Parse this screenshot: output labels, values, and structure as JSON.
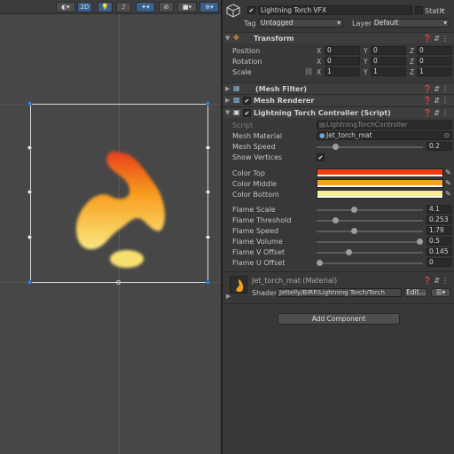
{
  "scene": {
    "toolbar": {
      "mode_2d": "2D",
      "shading_icon": "shading-mode-icon",
      "lighting_icon": "light-bulb-icon",
      "audio_icon": "audio-icon",
      "effects_icon": "effects-icon",
      "hidden_icon": "visibility-icon",
      "camera_icon": "camera-icon",
      "gizmos_icon": "gizmos-icon"
    }
  },
  "inspector": {
    "gameobject": {
      "active_checked": true,
      "name": "Lightning Torch VFX",
      "static_label": "Static",
      "tag_label": "Tag",
      "tag_value": "Untagged",
      "layer_label": "Layer",
      "layer_value": "Default"
    },
    "transform": {
      "title": "Transform",
      "position_label": "Position",
      "rotation_label": "Rotation",
      "scale_label": "Scale",
      "position": {
        "x": "0",
        "y": "0",
        "z": "0"
      },
      "rotation": {
        "x": "0",
        "y": "0",
        "z": "0"
      },
      "scale": {
        "x": "1",
        "y": "1",
        "z": "1"
      },
      "axis_x": "X",
      "axis_y": "Y",
      "axis_z": "Z"
    },
    "mesh_filter": {
      "title": "(Mesh Filter)"
    },
    "mesh_renderer": {
      "title": "Mesh Renderer"
    },
    "torch_controller": {
      "title": "Lightning Torch Controller (Script)",
      "script_label": "Script",
      "script_value": "LightningTorchController",
      "mesh_material_label": "Mesh Material",
      "mesh_material_value": "Jet_torch_mat",
      "mesh_speed_label": "Mesh Speed",
      "mesh_speed_value": "0.2",
      "mesh_speed_fraction": 0.18,
      "show_vertices_label": "Show Vertices",
      "show_vertices_checked": true,
      "color_top_label": "Color Top",
      "color_top": "#f23a10",
      "color_middle_label": "Color Middle",
      "color_middle": "#f8a020",
      "color_bottom_label": "Color Bottom",
      "color_bottom": "#f8f090",
      "flame_scale_label": "Flame Scale",
      "flame_scale_value": "4.1",
      "flame_scale_fraction": 0.35,
      "flame_threshold_label": "Flame Threshold",
      "flame_threshold_value": "0.253",
      "flame_threshold_fraction": 0.18,
      "flame_speed_label": "Flame Speed",
      "flame_speed_value": "1.79",
      "flame_speed_fraction": 0.35,
      "flame_volume_label": "Flame Volume",
      "flame_volume_value": "0.5",
      "flame_volume_fraction": 0.97,
      "flame_v_offset_label": "Flame V Offset",
      "flame_v_offset_value": "0.145",
      "flame_v_offset_fraction": 0.3,
      "flame_u_offset_label": "Flame U Offset",
      "flame_u_offset_value": "0",
      "flame_u_offset_fraction": 0.0
    },
    "material": {
      "name": "Jet_torch_mat (Material)",
      "shader_label": "Shader",
      "shader_value": "Jettelly/BIRP/Lightning Torch/Torch",
      "edit_label": "Edit..."
    },
    "add_component_label": "Add Component"
  }
}
